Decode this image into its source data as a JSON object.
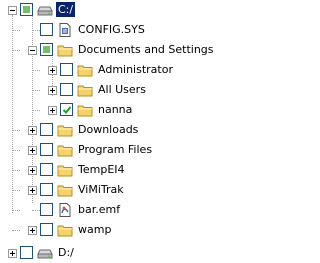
{
  "tree": {
    "items": [
      {
        "label": "C:/",
        "icon": "drive-icon",
        "check": "partial",
        "expander": "minus",
        "level": 0,
        "selected": true
      },
      {
        "label": "CONFIG.SYS",
        "icon": "sys-file-icon",
        "check": "unchecked",
        "expander": "none",
        "level": 1
      },
      {
        "label": "Documents and Settings",
        "icon": "folder-icon",
        "check": "partial",
        "expander": "minus",
        "level": 1
      },
      {
        "label": "Administrator",
        "icon": "folder-icon",
        "check": "unchecked",
        "expander": "plus",
        "level": 2
      },
      {
        "label": "All Users",
        "icon": "folder-icon",
        "check": "unchecked",
        "expander": "plus",
        "level": 2
      },
      {
        "label": "nanna",
        "icon": "folder-icon",
        "check": "checked",
        "expander": "plus",
        "level": 2
      },
      {
        "label": "Downloads",
        "icon": "folder-icon",
        "check": "unchecked",
        "expander": "plus",
        "level": 1
      },
      {
        "label": "Program Files",
        "icon": "folder-icon",
        "check": "unchecked",
        "expander": "plus",
        "level": 1
      },
      {
        "label": "TempEI4",
        "icon": "folder-icon",
        "check": "unchecked",
        "expander": "plus",
        "level": 1
      },
      {
        "label": "ViMiTrak",
        "icon": "folder-icon",
        "check": "unchecked",
        "expander": "plus",
        "level": 1
      },
      {
        "label": "bar.emf",
        "icon": "emf-file-icon",
        "check": "unchecked",
        "expander": "none",
        "level": 1
      },
      {
        "label": "wamp",
        "icon": "folder-icon",
        "check": "unchecked",
        "expander": "plus",
        "level": 1
      },
      {
        "label": "D:/",
        "icon": "drive-icon",
        "check": "unchecked",
        "expander": "plus",
        "level": 0
      }
    ]
  },
  "colors": {
    "selection": "#0a246a",
    "checkbox_border": "#1c5180",
    "partial_fill": "#73c167",
    "check_mark": "#21a121",
    "folder": "#f5d36b"
  }
}
